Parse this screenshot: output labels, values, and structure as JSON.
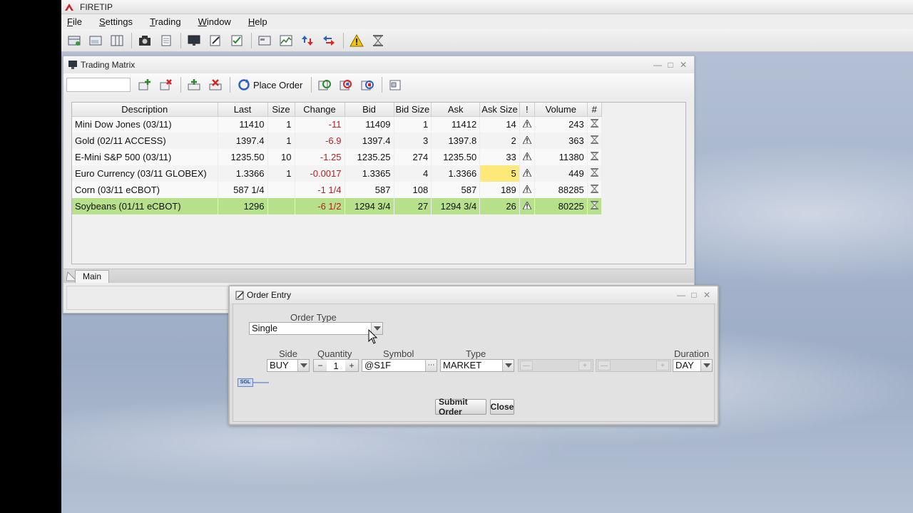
{
  "app": {
    "title": "FIRETIP",
    "menu": [
      {
        "label": "File",
        "mnemonic": "F"
      },
      {
        "label": "Settings",
        "mnemonic": "S"
      },
      {
        "label": "Trading",
        "mnemonic": "T"
      },
      {
        "label": "Window",
        "mnemonic": "W"
      },
      {
        "label": "Help",
        "mnemonic": "H"
      }
    ],
    "toolbar_icons": [
      "new-matrix-icon",
      "new-window-icon",
      "layout-icon",
      "camera-icon",
      "document-icon",
      "monitor-icon",
      "edit-icon",
      "checklist-icon",
      "news-icon",
      "chart-icon",
      "order-arrows-icon",
      "transfer-arrows-icon",
      "warning-icon",
      "hourglass-icon"
    ]
  },
  "trading_matrix": {
    "title": "Trading Matrix",
    "search_value": "",
    "place_order_label": "Place Order",
    "columns": [
      "Description",
      "Last",
      "Size",
      "Change",
      "Bid",
      "Bid Size",
      "Ask",
      "Ask Size",
      "!",
      "Volume",
      "#"
    ],
    "rows": [
      {
        "description": "Mini Dow Jones (03/11)",
        "last": "11410",
        "size": "1",
        "change": "-11",
        "bid": "11409",
        "bid_size": "1",
        "ask": "11412",
        "ask_size": "14",
        "volume": "243"
      },
      {
        "description": "Gold (02/11 ACCESS)",
        "last": "1397.4",
        "size": "1",
        "change": "-6.9",
        "bid": "1397.4",
        "bid_size": "3",
        "ask": "1397.8",
        "ask_size": "2",
        "volume": "363"
      },
      {
        "description": "E-Mini S&P 500 (03/11)",
        "last": "1235.50",
        "size": "10",
        "change": "-1.25",
        "bid": "1235.25",
        "bid_size": "274",
        "ask": "1235.50",
        "ask_size": "33",
        "volume": "11380"
      },
      {
        "description": "Euro Currency (03/11 GLOBEX)",
        "last": "1.3366",
        "size": "1",
        "change": "-0.0017",
        "bid": "1.3365",
        "bid_size": "4",
        "ask": "1.3366",
        "ask_size": "5",
        "volume": "449"
      },
      {
        "description": "Corn (03/11 eCBOT)",
        "last": "587 1/4",
        "size": "",
        "change": "-1 1/4",
        "bid": "587",
        "bid_size": "108",
        "ask": "587",
        "ask_size": "189",
        "volume": "88285"
      },
      {
        "description": "Soybeans (01/11 eCBOT)",
        "last": "1296",
        "size": "",
        "change": "-6 1/2",
        "bid": "1294 3/4",
        "bid_size": "27",
        "ask": "1294 3/4",
        "ask_size": "26",
        "volume": "80225"
      }
    ],
    "selected_row": 5,
    "highlighted_cell": {
      "row": 3,
      "column": "ask_size"
    },
    "tab_label": "Main"
  },
  "order_entry": {
    "title": "Order Entry",
    "order_type_label": "Order Type",
    "order_type_value": "Single",
    "badge": "SGL",
    "labels": {
      "side": "Side",
      "quantity": "Quantity",
      "symbol": "Symbol",
      "type": "Type",
      "duration": "Duration"
    },
    "values": {
      "side": "BUY",
      "quantity": "1",
      "symbol": "@S1F",
      "type": "MARKET",
      "duration": "DAY"
    },
    "submit_label": "Submit Order",
    "close_label": "Close"
  },
  "colors": {
    "negative": "#b22222",
    "selected_row": "#b7e08a",
    "highlight": "#fde97a"
  }
}
